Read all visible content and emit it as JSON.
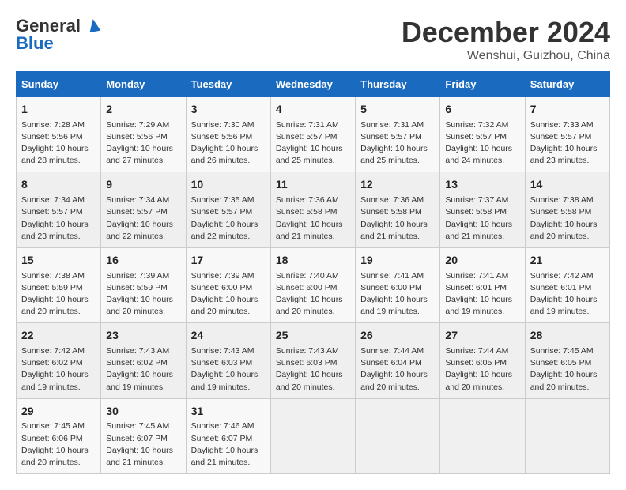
{
  "header": {
    "logo_general": "General",
    "logo_blue": "Blue",
    "month": "December 2024",
    "location": "Wenshui, Guizhou, China"
  },
  "calendar": {
    "days_of_week": [
      "Sunday",
      "Monday",
      "Tuesday",
      "Wednesday",
      "Thursday",
      "Friday",
      "Saturday"
    ],
    "weeks": [
      [
        {
          "day": "",
          "empty": true
        },
        {
          "day": "",
          "empty": true
        },
        {
          "day": "",
          "empty": true
        },
        {
          "day": "",
          "empty": true
        },
        {
          "day": "",
          "empty": true
        },
        {
          "day": "",
          "empty": true
        },
        {
          "day": "",
          "empty": true
        }
      ],
      [
        {
          "day": "1",
          "info": "Sunrise: 7:28 AM\nSunset: 5:56 PM\nDaylight: 10 hours\nand 28 minutes."
        },
        {
          "day": "2",
          "info": "Sunrise: 7:29 AM\nSunset: 5:56 PM\nDaylight: 10 hours\nand 27 minutes."
        },
        {
          "day": "3",
          "info": "Sunrise: 7:30 AM\nSunset: 5:56 PM\nDaylight: 10 hours\nand 26 minutes."
        },
        {
          "day": "4",
          "info": "Sunrise: 7:31 AM\nSunset: 5:57 PM\nDaylight: 10 hours\nand 25 minutes."
        },
        {
          "day": "5",
          "info": "Sunrise: 7:31 AM\nSunset: 5:57 PM\nDaylight: 10 hours\nand 25 minutes."
        },
        {
          "day": "6",
          "info": "Sunrise: 7:32 AM\nSunset: 5:57 PM\nDaylight: 10 hours\nand 24 minutes."
        },
        {
          "day": "7",
          "info": "Sunrise: 7:33 AM\nSunset: 5:57 PM\nDaylight: 10 hours\nand 23 minutes."
        }
      ],
      [
        {
          "day": "8",
          "info": "Sunrise: 7:34 AM\nSunset: 5:57 PM\nDaylight: 10 hours\nand 23 minutes."
        },
        {
          "day": "9",
          "info": "Sunrise: 7:34 AM\nSunset: 5:57 PM\nDaylight: 10 hours\nand 22 minutes."
        },
        {
          "day": "10",
          "info": "Sunrise: 7:35 AM\nSunset: 5:57 PM\nDaylight: 10 hours\nand 22 minutes."
        },
        {
          "day": "11",
          "info": "Sunrise: 7:36 AM\nSunset: 5:58 PM\nDaylight: 10 hours\nand 21 minutes."
        },
        {
          "day": "12",
          "info": "Sunrise: 7:36 AM\nSunset: 5:58 PM\nDaylight: 10 hours\nand 21 minutes."
        },
        {
          "day": "13",
          "info": "Sunrise: 7:37 AM\nSunset: 5:58 PM\nDaylight: 10 hours\nand 21 minutes."
        },
        {
          "day": "14",
          "info": "Sunrise: 7:38 AM\nSunset: 5:58 PM\nDaylight: 10 hours\nand 20 minutes."
        }
      ],
      [
        {
          "day": "15",
          "info": "Sunrise: 7:38 AM\nSunset: 5:59 PM\nDaylight: 10 hours\nand 20 minutes."
        },
        {
          "day": "16",
          "info": "Sunrise: 7:39 AM\nSunset: 5:59 PM\nDaylight: 10 hours\nand 20 minutes."
        },
        {
          "day": "17",
          "info": "Sunrise: 7:39 AM\nSunset: 6:00 PM\nDaylight: 10 hours\nand 20 minutes."
        },
        {
          "day": "18",
          "info": "Sunrise: 7:40 AM\nSunset: 6:00 PM\nDaylight: 10 hours\nand 20 minutes."
        },
        {
          "day": "19",
          "info": "Sunrise: 7:41 AM\nSunset: 6:00 PM\nDaylight: 10 hours\nand 19 minutes."
        },
        {
          "day": "20",
          "info": "Sunrise: 7:41 AM\nSunset: 6:01 PM\nDaylight: 10 hours\nand 19 minutes."
        },
        {
          "day": "21",
          "info": "Sunrise: 7:42 AM\nSunset: 6:01 PM\nDaylight: 10 hours\nand 19 minutes."
        }
      ],
      [
        {
          "day": "22",
          "info": "Sunrise: 7:42 AM\nSunset: 6:02 PM\nDaylight: 10 hours\nand 19 minutes."
        },
        {
          "day": "23",
          "info": "Sunrise: 7:43 AM\nSunset: 6:02 PM\nDaylight: 10 hours\nand 19 minutes."
        },
        {
          "day": "24",
          "info": "Sunrise: 7:43 AM\nSunset: 6:03 PM\nDaylight: 10 hours\nand 19 minutes."
        },
        {
          "day": "25",
          "info": "Sunrise: 7:43 AM\nSunset: 6:03 PM\nDaylight: 10 hours\nand 20 minutes."
        },
        {
          "day": "26",
          "info": "Sunrise: 7:44 AM\nSunset: 6:04 PM\nDaylight: 10 hours\nand 20 minutes."
        },
        {
          "day": "27",
          "info": "Sunrise: 7:44 AM\nSunset: 6:05 PM\nDaylight: 10 hours\nand 20 minutes."
        },
        {
          "day": "28",
          "info": "Sunrise: 7:45 AM\nSunset: 6:05 PM\nDaylight: 10 hours\nand 20 minutes."
        }
      ],
      [
        {
          "day": "29",
          "info": "Sunrise: 7:45 AM\nSunset: 6:06 PM\nDaylight: 10 hours\nand 20 minutes."
        },
        {
          "day": "30",
          "info": "Sunrise: 7:45 AM\nSunset: 6:07 PM\nDaylight: 10 hours\nand 21 minutes."
        },
        {
          "day": "31",
          "info": "Sunrise: 7:46 AM\nSunset: 6:07 PM\nDaylight: 10 hours\nand 21 minutes."
        },
        {
          "day": "",
          "empty": true
        },
        {
          "day": "",
          "empty": true
        },
        {
          "day": "",
          "empty": true
        },
        {
          "day": "",
          "empty": true
        }
      ]
    ]
  }
}
